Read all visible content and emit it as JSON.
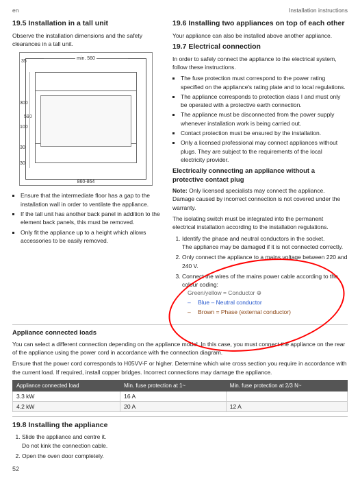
{
  "top": {
    "lang": "en",
    "section": "Installation instructions"
  },
  "left_col": {
    "section_title": "19.5  Installation in a tall unit",
    "intro": "Observe the installation dimensions and the safety clearances in a tall unit.",
    "diagram": {
      "dim_top": "min. 560",
      "dim_mid": "590",
      "dim_bottom": "860-864",
      "dim_left1": "35",
      "dim_left2": "300",
      "dim_left3": "100",
      "dim_left4": "30",
      "dim_left5": "30"
    },
    "bullets": [
      "Ensure that the intermediate floor has a gap to the installation wall in order to ventilate the appliance.",
      "If the tall unit has another back panel in addition to the element back panels, this must be removed.",
      "Only fit the appliance up to a height which allows accessories to be easily removed."
    ]
  },
  "right_col": {
    "section_196_title": "19.6  Installing two appliances on top of each other",
    "section_196_text": "Your appliance can also be installed above another appliance.",
    "section_197_title": "19.7  Electrical connection",
    "section_197_intro": "In order to safely connect the appliance to the electrical system, follow these instructions.",
    "bullets_197": [
      "The fuse protection must correspond to the power rating specified on the appliance's rating plate and to local regulations.",
      "The appliance corresponds to protection class I and must only be operated with a protective earth connection.",
      "The appliance must be disconnected from the power supply whenever installation work is being carried out.",
      "Contact protection must be ensured by the installation.",
      "Only a licensed professional may connect appliances without plugs. They are subject to the requirements of the local electricity provider."
    ],
    "section_197b_title": "Electrically connecting an appliance without a protective contact plug",
    "section_197b_note_label": "Note:",
    "section_197b_note": " Only licensed specialists may connect the appliance. Damage caused by incorrect connection is not covered under the warranty.",
    "section_197b_text2": "The isolating switch must be integrated into the permanent electrical installation according to the installation regulations.",
    "steps": [
      {
        "num": "1.",
        "text": "Identify the phase and neutral conductors in the socket.",
        "sub": "The appliance may be damaged if it is not connected correctly."
      },
      {
        "num": "2.",
        "text": "Only connect the appliance to a mains voltage between 220 and 240 V."
      },
      {
        "num": "3.",
        "text": "Connect the wires of the mains power cable according to the colour coding:",
        "colors": [
          "Green/yellow = Conductor ⊕",
          "Blue – Neutral conductor",
          "Brown = Phase (external conductor)"
        ]
      }
    ]
  },
  "appliance_loads": {
    "title": "Appliance connected loads",
    "intro": "You can select a different connection depending on the appliance model. In this case, you must connect the appliance on the rear of the appliance using the power cord in accordance with the connection diagram.",
    "intro2": "Ensure that the power cord corresponds to H05VV-F or higher. Determine which wire cross section you require in accordance with the current load. If required, install copper bridges. Incorrect connections may damage the appliance.",
    "table_headers": [
      "Appliance connected load",
      "Min. fuse protection at 1~",
      "Min. fuse protection at 2/3 N~"
    ],
    "table_rows": [
      [
        "3.3 kW",
        "16 A",
        ""
      ],
      [
        "4.2 kW",
        "20 A",
        "12 A"
      ]
    ]
  },
  "section_198": {
    "title": "19.8  Installing the appliance",
    "steps": [
      "Slide the appliance and centre it.\nDo not kink the connection cable.",
      "Open the oven door completely."
    ]
  },
  "page_number": "52"
}
